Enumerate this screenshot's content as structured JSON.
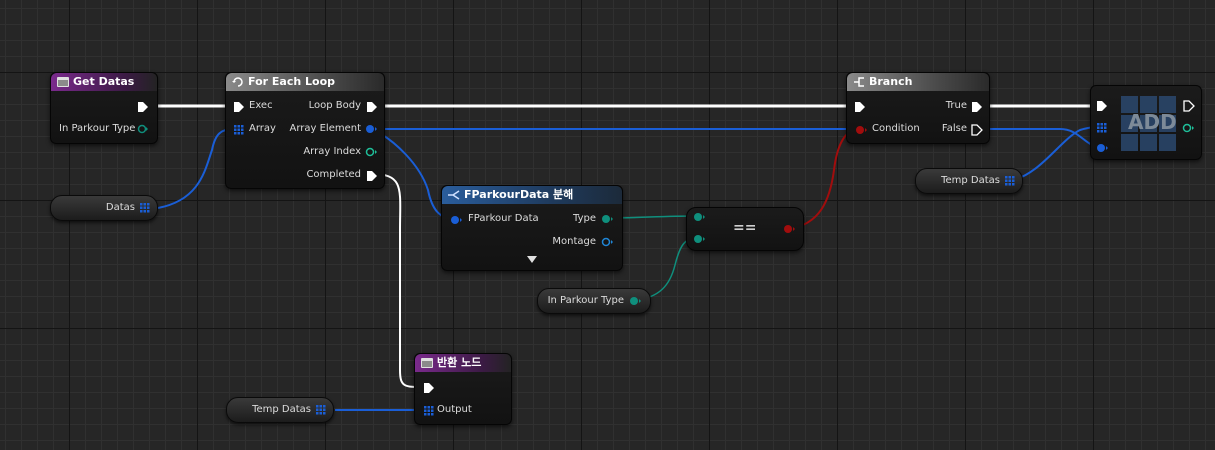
{
  "colors": {
    "exec": "#ffffff",
    "array": "#1a5ed6",
    "enum": "#0f8f7d",
    "bool": "#a10d0d"
  },
  "nodes": {
    "get_datas": {
      "title": "Get Datas",
      "in_label": "In Parkour Type"
    },
    "for_each": {
      "title": "For Each Loop",
      "exec": "Exec",
      "array": "Array",
      "loop_body": "Loop Body",
      "array_element": "Array Element",
      "array_index": "Array Index",
      "completed": "Completed"
    },
    "branch": {
      "title": "Branch",
      "condition": "Condition",
      "true_label": "True",
      "false_label": "False"
    },
    "break_struct": {
      "title": "FParkourData 분해",
      "in_label": "FParkour Data",
      "type": "Type",
      "montage": "Montage"
    },
    "equals": {
      "symbol": "=="
    },
    "add": {
      "label": "ADD"
    },
    "return": {
      "title": "반환 노드",
      "output": "Output"
    }
  },
  "variables": {
    "datas": "Datas",
    "temp_datas_top": "Temp Datas",
    "temp_datas_bottom": "Temp Datas",
    "in_parkour_type": "In Parkour Type"
  }
}
